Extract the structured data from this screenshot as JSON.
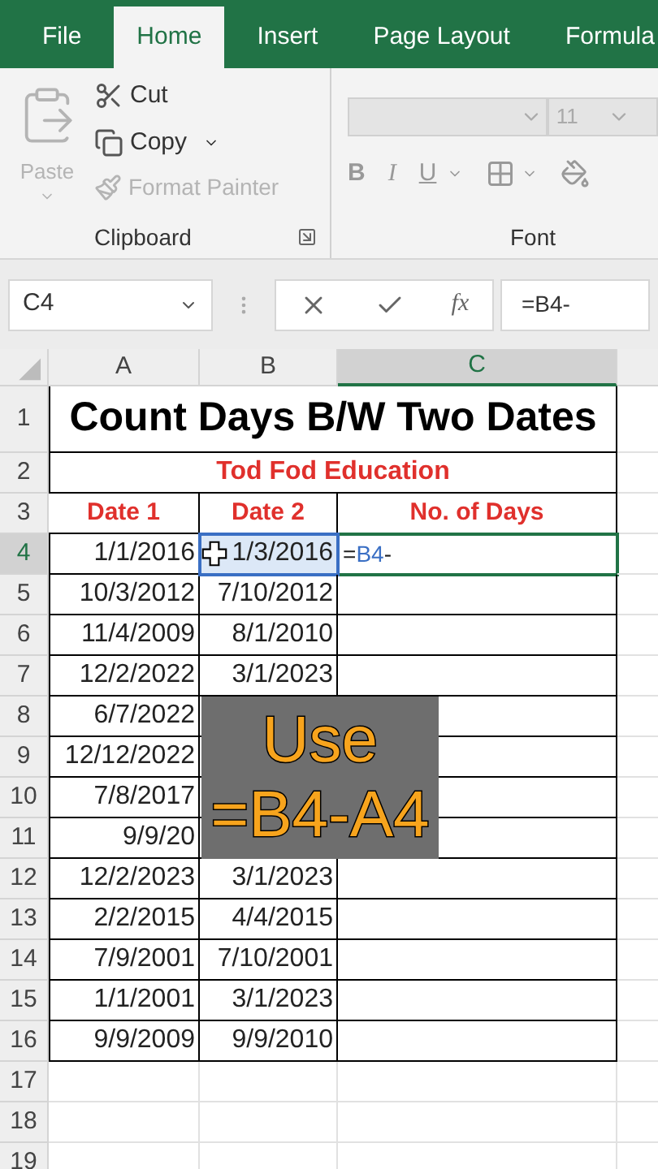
{
  "tabs": [
    {
      "label": "File",
      "selected": false
    },
    {
      "label": "Home",
      "selected": true
    },
    {
      "label": "Insert",
      "selected": false
    },
    {
      "label": "Page Layout",
      "selected": false
    },
    {
      "label": "Formula",
      "selected": false
    }
  ],
  "ribbon": {
    "clipboard": {
      "paste": {
        "label": "Paste",
        "disabled": true
      },
      "cut": {
        "label": "Cut",
        "disabled": false
      },
      "copy": {
        "label": "Copy",
        "disabled": false
      },
      "format_painter": {
        "label": "Format Painter",
        "disabled": true
      },
      "group_label": "Clipboard"
    },
    "font": {
      "size": "11",
      "style_buttons": [
        "B",
        "I",
        "U"
      ],
      "group_label": "Font"
    }
  },
  "formula_bar": {
    "name_box": "C4",
    "fx": "fx",
    "formula": "=B4-"
  },
  "columns": [
    {
      "label": "A",
      "selected": false
    },
    {
      "label": "B",
      "selected": false
    },
    {
      "label": "C",
      "selected": true
    }
  ],
  "rows": [
    {
      "number": "1",
      "kind": "title",
      "text": "Count Days B/W Two Dates",
      "selected": false
    },
    {
      "number": "2",
      "kind": "subtitle",
      "text": "Tod Fod Education",
      "selected": false
    },
    {
      "number": "3",
      "kind": "header",
      "cells": [
        "Date 1",
        "Date 2",
        "No. of Days"
      ],
      "selected": false
    },
    {
      "number": "4",
      "kind": "data",
      "a": "1/1/2016",
      "b": "1/3/2016",
      "c_parts": [
        {
          "text": "=",
          "ref": false
        },
        {
          "text": "B4",
          "ref": true
        },
        {
          "text": "-",
          "ref": false
        }
      ],
      "selected": true,
      "referenced": true
    },
    {
      "number": "5",
      "kind": "data",
      "a": "10/3/2012",
      "b": "7/10/2012",
      "selected": false,
      "referenced": false
    },
    {
      "number": "6",
      "kind": "data",
      "a": "11/4/2009",
      "b": "8/1/2010",
      "selected": false,
      "referenced": false
    },
    {
      "number": "7",
      "kind": "data",
      "a": "12/2/2022",
      "b": "3/1/2023",
      "selected": false,
      "referenced": false
    },
    {
      "number": "8",
      "kind": "data",
      "a": "6/7/2022",
      "selected": false,
      "referenced": false
    },
    {
      "number": "9",
      "kind": "data",
      "a": "12/12/2022",
      "selected": false,
      "referenced": false
    },
    {
      "number": "10",
      "kind": "data",
      "a": "7/8/2017",
      "selected": false,
      "referenced": false
    },
    {
      "number": "11",
      "kind": "data",
      "a": "9/9/20",
      "selected": false,
      "referenced": false
    },
    {
      "number": "12",
      "kind": "data",
      "a": "12/2/2023",
      "b": "3/1/2023",
      "selected": false,
      "referenced": false
    },
    {
      "number": "13",
      "kind": "data",
      "a": "2/2/2015",
      "b": "4/4/2015",
      "selected": false,
      "referenced": false
    },
    {
      "number": "14",
      "kind": "data",
      "a": "7/9/2001",
      "b": "7/10/2001",
      "selected": false,
      "referenced": false
    },
    {
      "number": "15",
      "kind": "data",
      "a": "1/1/2001",
      "b": "3/1/2023",
      "selected": false,
      "referenced": false
    },
    {
      "number": "16",
      "kind": "data",
      "a": "9/9/2009",
      "b": "9/9/2010",
      "selected": false,
      "referenced": false
    },
    {
      "number": "17",
      "kind": "empty",
      "selected": false
    },
    {
      "number": "18",
      "kind": "empty",
      "selected": false
    },
    {
      "number": "19",
      "kind": "empty",
      "selected": false
    }
  ],
  "caption": {
    "lines": [
      "Use",
      "=B4-A4"
    ]
  }
}
